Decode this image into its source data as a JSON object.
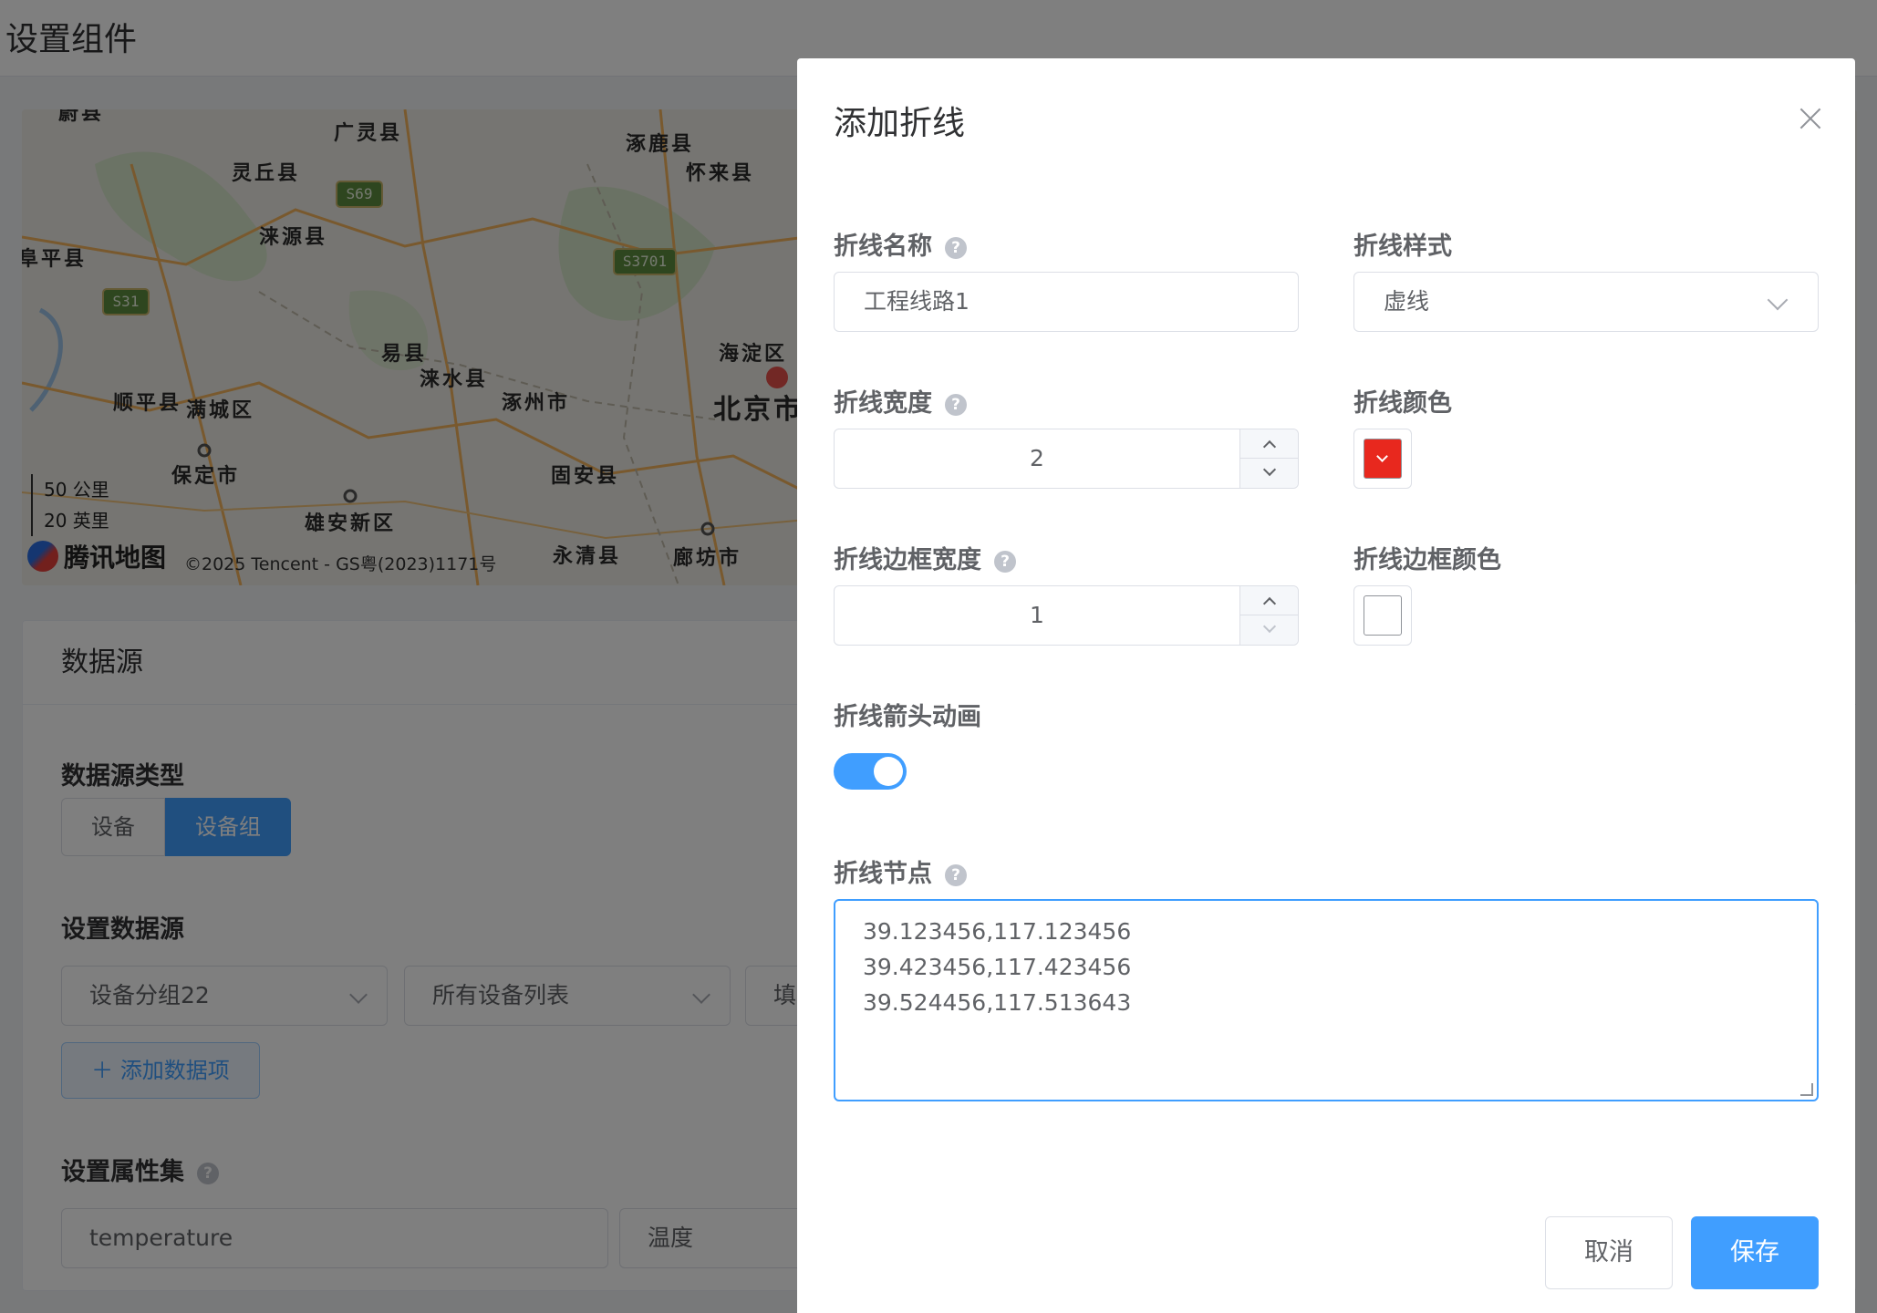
{
  "page": {
    "title": "设置组件"
  },
  "map": {
    "labels": [
      "蔚县",
      "广灵县",
      "涿鹿县",
      "灵丘县",
      "怀来县",
      "涞源县",
      "阜平县",
      "易县",
      "海淀区",
      "涞水县",
      "顺平县",
      "满城区",
      "涿州市",
      "北京市",
      "保定市",
      "固安县",
      "雄安新区",
      "永清县",
      "廊坊市"
    ],
    "roads": [
      "S69",
      "S3701",
      "S31"
    ],
    "scale_km": "50 公里",
    "scale_mi": "20 英里",
    "logo": "腾讯地图",
    "copyright": "©2025 Tencent - GS粤(2023)1171号"
  },
  "datasource": {
    "title": "数据源",
    "type_label": "数据源类型",
    "type_options": [
      "设备",
      "设备组"
    ],
    "set_label": "设置数据源",
    "group_select": "设备分组22",
    "device_select": "所有设备列表",
    "fill_stub": "填",
    "add_item": "添加数据项",
    "add_icon": "plus-icon",
    "attr_label": "设置属性集",
    "attr_value": "temperature",
    "attr_name": "温度"
  },
  "dialog": {
    "title": "添加折线",
    "name_label": "折线名称",
    "name_value": "工程线路1",
    "style_label": "折线样式",
    "style_value": "虚线",
    "width_label": "折线宽度",
    "width_value": "2",
    "color_label": "折线颜色",
    "color_value": "#e8281e",
    "border_width_label": "折线边框宽度",
    "border_width_value": "1",
    "border_color_label": "折线边框颜色",
    "border_color_value": "#ffffff",
    "arrow_label": "折线箭头动画",
    "arrow_enabled": true,
    "nodes_label": "折线节点",
    "nodes": [
      "39.123456,117.123456",
      "39.423456,117.423456",
      "39.524456,117.513643"
    ],
    "help_glyph": "?",
    "cancel": "取消",
    "save": "保存"
  },
  "colors": {
    "primary": "#409eff",
    "overlay": "rgba(0,0,0,0.5)"
  }
}
